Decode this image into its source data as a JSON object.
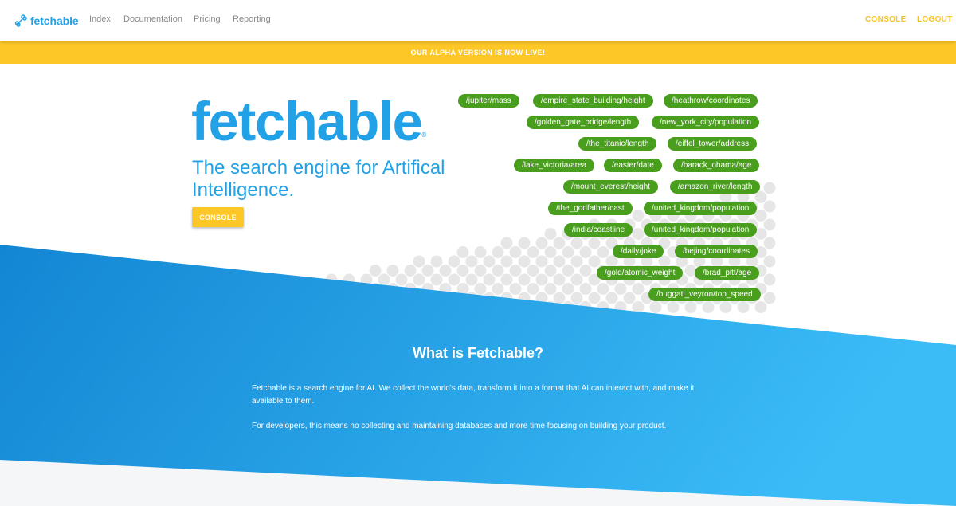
{
  "nav": {
    "brand": "fetchable",
    "links": [
      "Index",
      "Documentation",
      "Pricing",
      "Reporting"
    ],
    "console": "CONSOLE",
    "logout": "LOGOUT"
  },
  "alert": "OUR ALPHA VERSION IS NOW LIVE!",
  "hero": {
    "logo": "fetchable",
    "registered": "®",
    "tagline": "The search engine for Artifical Intelligence.",
    "button": "CONSOLE"
  },
  "tags": [
    "/jupiter/mass",
    "/empire_state_building/height",
    "/heathrow/coordinates",
    "/golden_gate_bridge/length",
    "/new_york_city/population",
    "/the_titanic/length",
    "/eiffel_tower/address",
    "/lake_victoria/area",
    "/easter/date",
    "/barack_obama/age",
    "/mount_everest/height",
    "/amazon_river/length",
    "/the_godfather/cast",
    "/united_kingdom/population",
    "/india/coastline",
    "/united_kingdom/population",
    "/daily/joke",
    "/bejing/coordinates",
    "/gold/atomic_weight",
    "/brad_pitt/age",
    "/buggati_veyron/top_speed"
  ],
  "about": {
    "title": "What is Fetchable?",
    "p1": "Fetchable is a search engine for AI. We collect the world's data, transform it into a format that AI can interact with, and make it available to them.",
    "p2": "For developers, this means no collecting and maintaining databases and more time focusing on building your product."
  },
  "colors": {
    "brand_blue": "#23a1e6",
    "accent_yellow": "#fdc727",
    "tag_green": "#4a9e1e"
  }
}
